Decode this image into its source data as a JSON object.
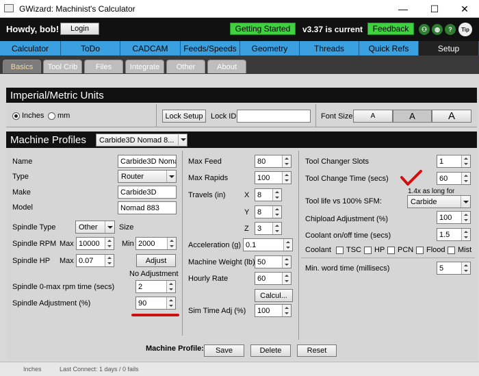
{
  "window": {
    "title": "GWizard: Machinist's Calculator",
    "minimize": "—",
    "maximize": "☐",
    "close": "✕"
  },
  "header": {
    "greeting": "Howdy, bob!",
    "login": "Login",
    "getting_started": "Getting Started",
    "version": "v3.37 is current",
    "feedback": "Feedback",
    "icons": [
      "people-icon",
      "globe-icon",
      "help-icon",
      "tip-icon"
    ],
    "help_glyph": "?",
    "tip_glyph": "Tip"
  },
  "main_tabs": [
    "Calculator",
    "ToDo",
    "CADCAM",
    "Feeds/Speeds",
    "Geometry",
    "Threads",
    "Quick Refs",
    "Setup"
  ],
  "sub_tabs": [
    "Basics",
    "Tool Crib",
    "Files",
    "Integrate",
    "Other",
    "About"
  ],
  "units": {
    "title": "Imperial/Metric Units",
    "inches": "Inches",
    "mm": "mm",
    "lock_setup": "Lock Setup",
    "lock_id_label": "Lock ID",
    "lock_id_value": "",
    "font_size_label": "Font Size",
    "font_small": "A",
    "font_medium": "A",
    "font_large": "A"
  },
  "profiles": {
    "title": "Machine Profiles",
    "selected": "Carbide3D Nomad 8...",
    "left": {
      "name_label": "Name",
      "name_value": "Carbide3D Noma",
      "type_label": "Type",
      "type_value": "Router",
      "make_label": "Make",
      "make_value": "Carbide3D",
      "model_label": "Model",
      "model_value": "Nomad 883",
      "spindle_type_label": "Spindle Type",
      "spindle_type_value": "Other",
      "size_label": "Size",
      "spindle_rpm_label": "Spindle RPM",
      "max_label": "Max",
      "rpm_max": "10000",
      "min_label": "Min",
      "rpm_min": "2000",
      "spindle_hp_label": "Spindle HP",
      "hp_max_label": "Max",
      "hp_max": "0.07",
      "adjust": "Adjust",
      "no_adjustment": "No Adjustment",
      "spindle_time_label": "Spindle 0-max rpm time (secs)",
      "spindle_time": "2",
      "spindle_adj_label": "Spindle Adjustment (%)",
      "spindle_adj": "90"
    },
    "middle": {
      "max_feed_label": "Max Feed",
      "max_feed": "80",
      "max_rapids_label": "Max Rapids",
      "max_rapids": "100",
      "travels_label": "Travels (in)",
      "x_label": "X",
      "x": "8",
      "y_label": "Y",
      "y": "8",
      "z_label": "Z",
      "z": "3",
      "accel_label": "Acceleration (g)",
      "accel": "0.1",
      "weight_label": "Machine Weight (lb)",
      "weight": "50",
      "hourly_label": "Hourly Rate",
      "hourly": "60",
      "calc": "Calcul...",
      "sim_label": "Sim Time Adj (%)",
      "sim": "100"
    },
    "right": {
      "tc_slots_label": "Tool Changer Slots",
      "tc_slots": "1",
      "tc_time_label": "Tool Change Time (secs)",
      "tc_time": "60",
      "life_label": "Tool life vs 100% SFM:",
      "life_note": "1.4x as long for",
      "life_value": "Carbide",
      "chipload_label": "Chipload Adjustment (%)",
      "chipload": "100",
      "coolant_time_label": "Coolant on/off time (secs)",
      "coolant_time": "1.5",
      "coolant_label": "Coolant",
      "coolant_opts": [
        "TSC",
        "HP",
        "PCN",
        "Flood",
        "Mist"
      ],
      "min_word_label": "Min. word time (millisecs)",
      "min_word": "5"
    },
    "footer": {
      "label": "Machine Profile:",
      "save": "Save",
      "delete": "Delete",
      "reset": "Reset"
    }
  },
  "status": {
    "units": "Inches",
    "last_connect": "Last Connect: 1 days / 0 fails"
  },
  "colors": {
    "tab_blue": "#3ba0e0",
    "green": "#3fd13f",
    "annotation_red": "#cc1111"
  }
}
